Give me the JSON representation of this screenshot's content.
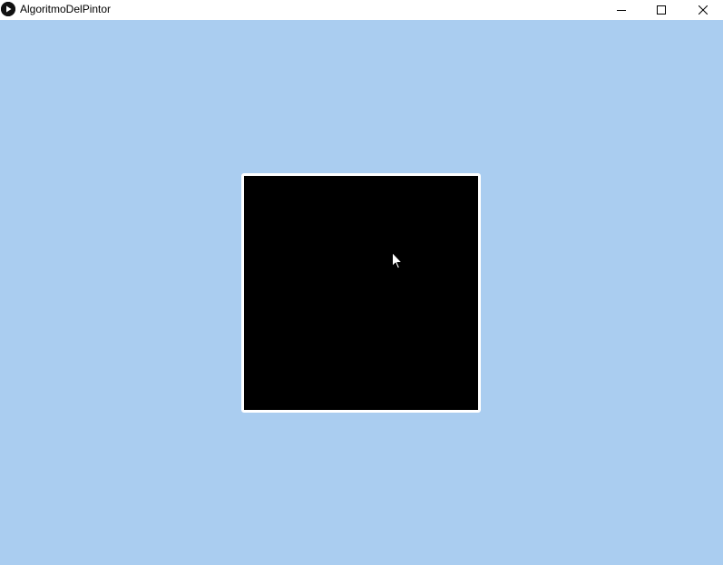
{
  "window": {
    "title": "AlgoritmoDelPintor",
    "icon": "processing-play-icon",
    "controls": {
      "minimize_icon": "minimize-icon",
      "maximize_icon": "maximize-icon",
      "close_icon": "close-icon"
    }
  },
  "canvas": {
    "background_color": "#aacdf0",
    "viewport_fill": "#000000",
    "viewport_border": "#ffffff"
  },
  "cursor": {
    "icon": "arrow-cursor-icon"
  }
}
